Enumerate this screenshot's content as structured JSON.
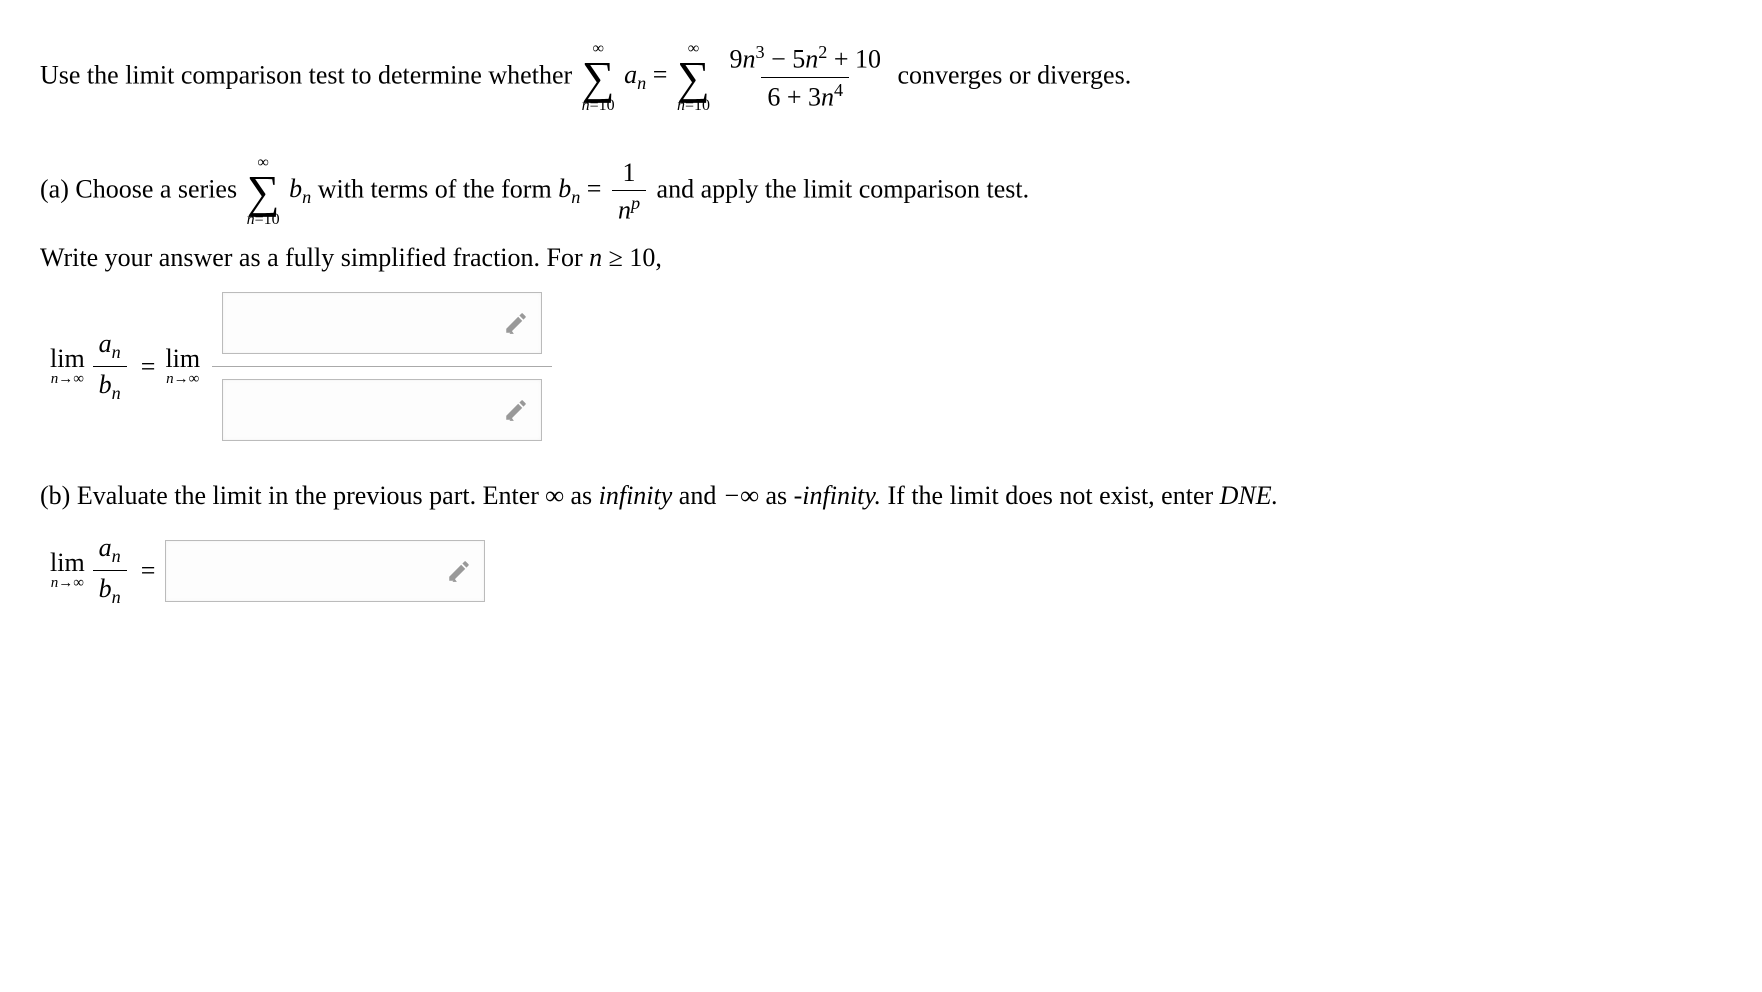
{
  "intro": {
    "prefix": "Use the limit comparison test to determine whether ",
    "sum_top": "∞",
    "sum_bottom_var": "n",
    "sum_bottom_eq": "=",
    "sum_bottom_val": "10",
    "an": "a",
    "an_sub": "n",
    "equals": " = ",
    "frac_num_c1": "9",
    "frac_num_v1": "n",
    "frac_num_e1": "3",
    "frac_num_op1": " − 5",
    "frac_num_v2": "n",
    "frac_num_e2": "2",
    "frac_num_op2": " + 10",
    "frac_den_c1": "6 + 3",
    "frac_den_v1": "n",
    "frac_den_e1": "4",
    "suffix": " converges or diverges."
  },
  "part_a": {
    "label": "(a) Choose a series ",
    "text_mid": " with terms of the form ",
    "bn": "b",
    "bn_sub": "n",
    "eq": " = ",
    "frac_num": "1",
    "frac_den_v": "n",
    "frac_den_e": "p",
    "text_after": " and apply the limit comparison test.",
    "line2_prefix": "Write your answer as a fully simplified fraction. For ",
    "line2_var": "n",
    "line2_op": " ≥ ",
    "line2_val": "10",
    "line2_comma": ",",
    "lim": "lim",
    "lim_sub_var": "n",
    "lim_sub_arrow": "→∞",
    "an_var": "a",
    "bn_var": "b"
  },
  "part_b": {
    "prefix": "(b) Evaluate the limit in the previous part. Enter ",
    "inf_sym": "∞",
    "as1": " as ",
    "inf_word": "infinity",
    "and": " and ",
    "ninf_sym": "−∞",
    "as2": " as ",
    "ninf_word": "-infinity.",
    "suffix": " If the limit does not exist, enter ",
    "dne": "DNE.",
    "lim": "lim",
    "lim_sub_var": "n",
    "lim_sub_arrow": "→∞",
    "an": "a",
    "bn": "b",
    "eq": " = "
  }
}
